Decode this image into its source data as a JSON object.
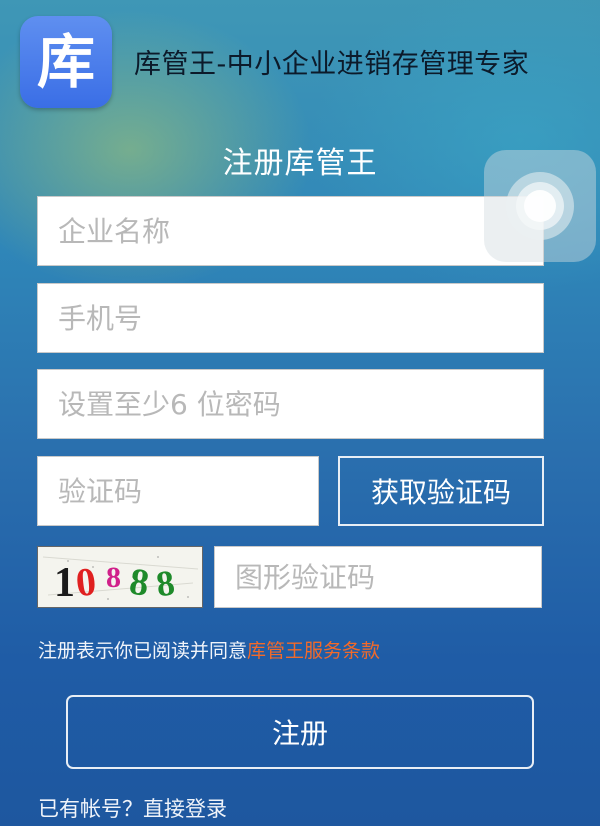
{
  "header": {
    "app_icon_char": "库",
    "app_title": "库管王-中小企业进销存管理专家"
  },
  "page_title": "注册库管王",
  "form": {
    "company_placeholder": "企业名称",
    "phone_placeholder": "手机号",
    "password_placeholder": "设置至少6 位密码",
    "sms_code_placeholder": "验证码",
    "get_code_label": "获取验证码",
    "captcha_text": "10888",
    "captcha_placeholder": "图形验证码"
  },
  "terms": {
    "prefix": "注册表示你已阅读并同意",
    "link_text": "库管王服务条款"
  },
  "register_label": "注册",
  "login_link": "已有帐号？直接登录",
  "colors": {
    "accent_link": "#f26a2a",
    "app_icon": "#4a7ce8"
  },
  "icons": {
    "assistive_touch": "assistive-touch-icon"
  }
}
